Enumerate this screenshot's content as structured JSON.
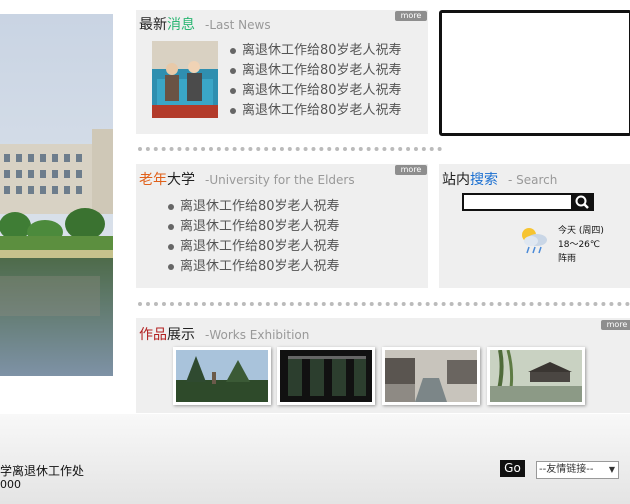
{
  "latest_news": {
    "title_a": "最新",
    "title_b": "消息",
    "subtitle": "-Last News",
    "more": "more",
    "items": [
      "离退休工作给80岁老人祝寿",
      "离退休工作给80岁老人祝寿",
      "离退休工作给80岁老人祝寿",
      "离退休工作给80岁老人祝寿"
    ]
  },
  "university": {
    "title_a": "老年",
    "title_b": "大学",
    "subtitle": "-University for the Elders",
    "more": "more",
    "items": [
      "离退休工作给80岁老人祝寿",
      "离退休工作给80岁老人祝寿",
      "离退休工作给80岁老人祝寿",
      "离退休工作给80岁老人祝寿"
    ]
  },
  "search": {
    "title_a": "站内",
    "title_b": "搜索",
    "subtitle": "- Search",
    "input_value": ""
  },
  "weather": {
    "today": "今天 (周四)",
    "temp": "18～26℃",
    "condition": "阵雨"
  },
  "works": {
    "title_a": "作品",
    "title_b": "展示",
    "subtitle": "-Works Exhibition",
    "more": "more"
  },
  "footer": {
    "line1": "学离退休工作处",
    "line2": "000",
    "go": "Go",
    "links_select": "--友情链接--"
  },
  "colors": {
    "green": "#2bb673",
    "orange": "#e0601a",
    "blue": "#1a6fd1",
    "darkred": "#b21f1f"
  }
}
